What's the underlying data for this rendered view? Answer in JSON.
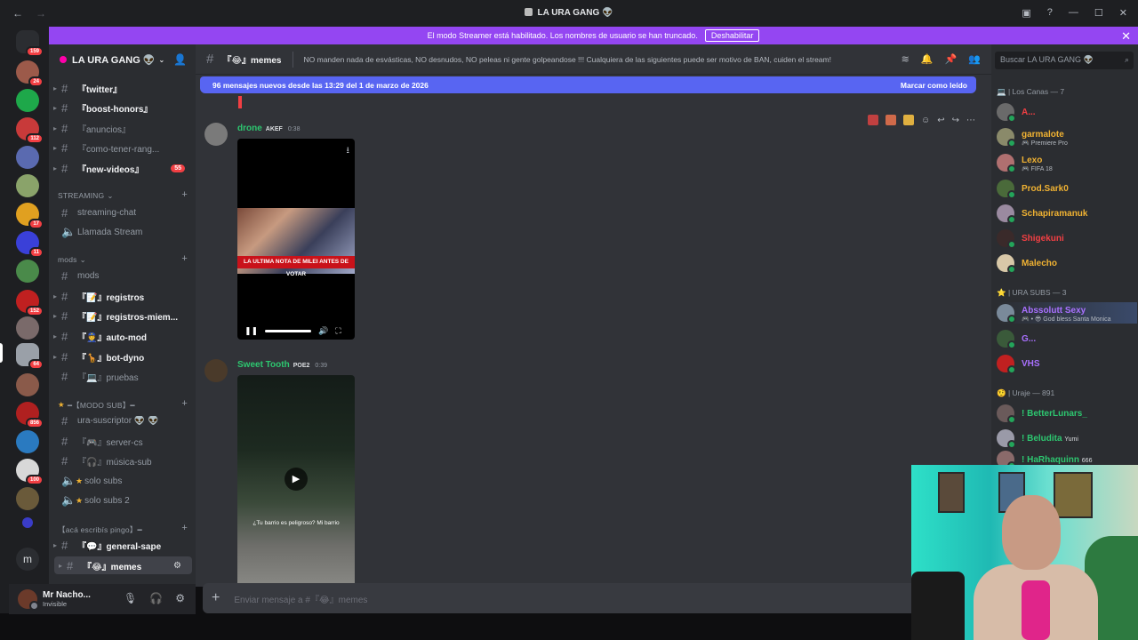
{
  "titlebar": {
    "title": "LA URA GANG 👽",
    "back": "←",
    "forward": "→"
  },
  "banner": {
    "text": "El modo Streamer está habilitado. Los nombres de usuario se han truncado.",
    "button": "Deshabilitar",
    "close": "✕"
  },
  "rail": {
    "badges": [
      "159",
      "24",
      "112",
      "17",
      "11",
      "152",
      "64",
      "856",
      "100"
    ]
  },
  "server": {
    "name": "LA URA GANG 👽",
    "channels": [
      {
        "label": "『twitter』",
        "bright": true
      },
      {
        "label": "『boost-honors』",
        "bright": true
      },
      {
        "label": "『anuncios』",
        "bright": false
      },
      {
        "label": "『como-tener-rang...",
        "bright": false
      },
      {
        "label": "『new-videos』",
        "bright": true,
        "unread": "55"
      }
    ],
    "cat_streaming": "STREAMING",
    "streaming": [
      "streaming-chat",
      "Llamada Stream"
    ],
    "cat_mods": "mods",
    "mods": [
      {
        "label": "mods",
        "bright": false
      },
      {
        "label": "『📝』registros",
        "bright": true
      },
      {
        "label": "『📝』registros-miem...",
        "bright": true
      },
      {
        "label": "『👮』auto-mod",
        "bright": true
      },
      {
        "label": "『🦒』bot-dyno",
        "bright": true
      },
      {
        "label": "『💻』pruebas",
        "bright": false
      }
    ],
    "cat_sub": "━【MODO SUB】━",
    "sub": [
      "ura-suscriptor 👽 👽",
      "『🎮』server-cs",
      "『🎧』música-sub",
      "solo subs",
      "solo subs 2"
    ],
    "cat_pingo": "【acá escribís pingo】━",
    "pingo": [
      {
        "label": "『💬』general-sape",
        "bright": true
      },
      {
        "label": "『😂』memes",
        "active": true
      }
    ]
  },
  "user": {
    "name": "Mr Nacho...",
    "status": "Invisible"
  },
  "header": {
    "channel": "『😂』memes",
    "topic": "NO manden nada de esvásticas, NO desnudos, NO peleas ni gente golpeandose !!! Cualquiera de las siguientes puede ser motivo de BAN, cuiden el stream!"
  },
  "chat": {
    "new_messages": "96 mensajes nuevos desde las 13:29 del 1 de marzo de 2026",
    "mark_read": "Marcar como leído",
    "messages": [
      {
        "author": "drone",
        "tag": "AKEF",
        "time": "0:38",
        "caption": "LA ULTIMA NOTA DE MILEI ANTES DE VOTAR"
      },
      {
        "author": "Sweet Tooth",
        "tag": "POE2",
        "time": "0:39",
        "caption": "¿Tu barrio es peligroso? Mi barrio"
      }
    ],
    "input_placeholder": "Enviar mensaje a #『😂』memes"
  },
  "members": {
    "search_placeholder": "Buscar LA URA GANG 👽",
    "groups": [
      {
        "label": "💻 | Los Canas — 7",
        "items": [
          {
            "name": "A...",
            "color": "#f23f43",
            "status": ""
          },
          {
            "name": "garmalote",
            "color": "#f0b232",
            "status": "🎮 Premiere Pro"
          },
          {
            "name": "Lexo",
            "color": "#f0b232",
            "status": "🎮 FIFA 18"
          },
          {
            "name": "Prod.Sark0",
            "color": "#f0b232",
            "status": ""
          },
          {
            "name": "Schapiramanuk",
            "color": "#f0b232",
            "status": ""
          },
          {
            "name": "Shigekuni",
            "color": "#f23f43",
            "status": ""
          },
          {
            "name": "Malecho",
            "color": "#f0b232",
            "status": ""
          }
        ]
      },
      {
        "label": "⭐ | URA SUBS — 3",
        "items": [
          {
            "name": "Abssolutt Sexy",
            "color": "#a970ff",
            "status": "🎮 • 😎 God bless Santa Monica"
          },
          {
            "name": "G...",
            "color": "#a970ff",
            "status": ""
          },
          {
            "name": "VHS",
            "color": "#a970ff",
            "status": ""
          }
        ]
      },
      {
        "label": "🤨 | Uraje — 891",
        "items": [
          {
            "name": "! BetterLunars_",
            "color": "#2dc770",
            "status": ""
          },
          {
            "name": "! Beludita",
            "color": "#2dc770",
            "status": "",
            "tag": "Yumi"
          },
          {
            "name": "! HaRhaquinn",
            "color": "#2dc770",
            "status": "",
            "tag": "666"
          }
        ]
      }
    ]
  },
  "colors": {
    "accent": "#5865f2",
    "banner": "#9446f2",
    "online": "#23a55a"
  }
}
